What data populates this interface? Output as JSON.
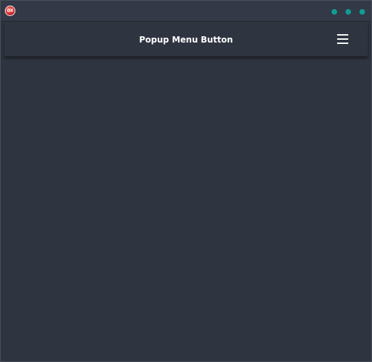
{
  "titlebar": {
    "app_icon_text": "DX",
    "window_dots": [
      "dot",
      "dot",
      "dot"
    ]
  },
  "toolbar": {
    "title": "Popup Menu Button",
    "menu_icon": "hamburger-menu-icon"
  },
  "colors": {
    "background": "#2e3440",
    "titlebar": "#333946",
    "accent_dot": "#0f9c94",
    "app_icon": "#d22a2a",
    "text": "#ffffff"
  }
}
